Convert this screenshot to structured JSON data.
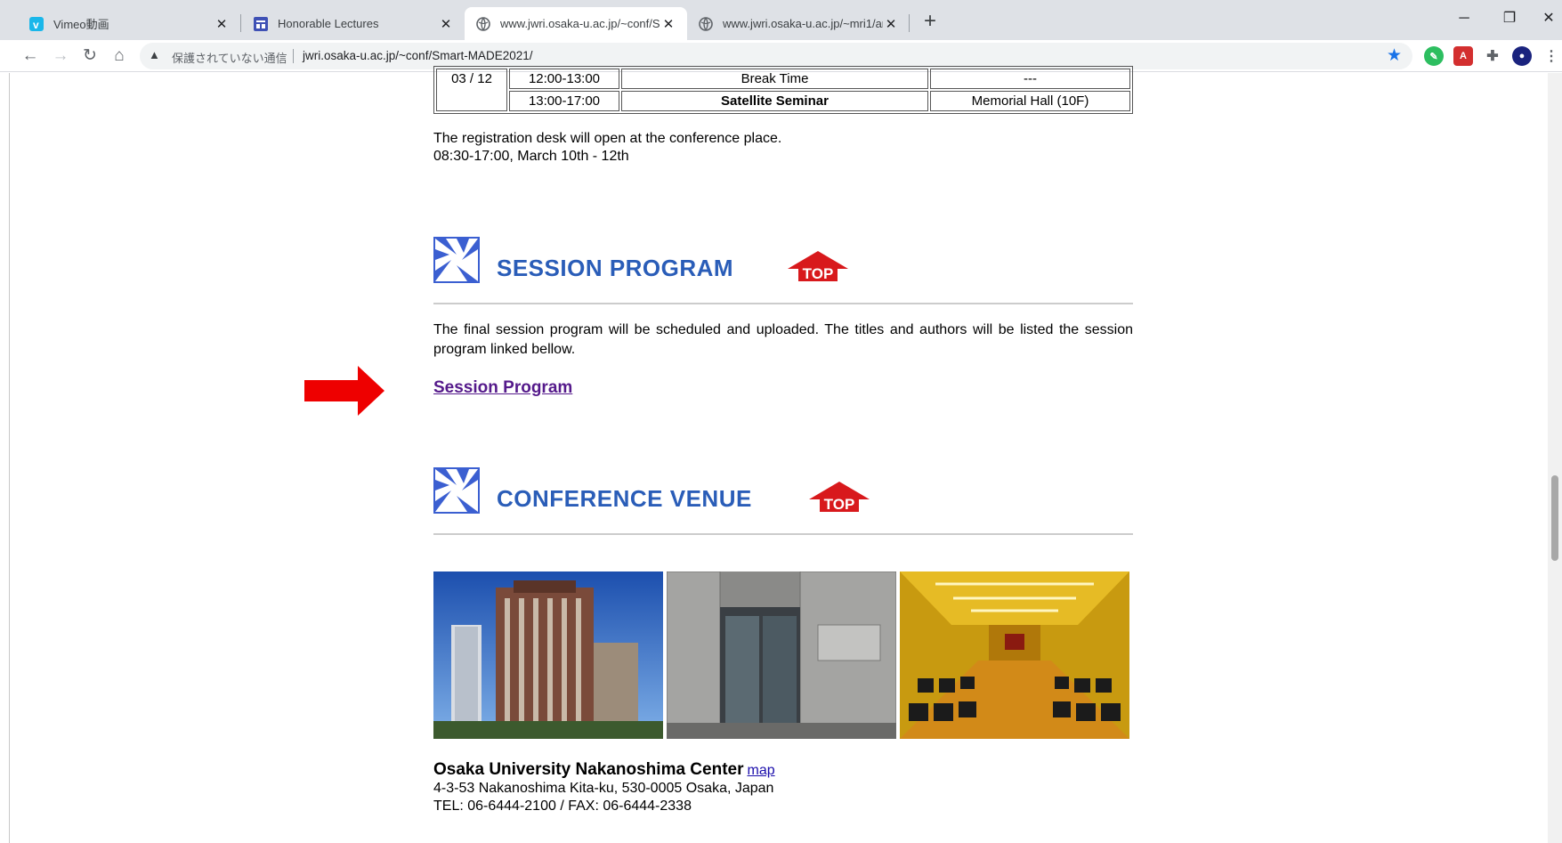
{
  "browser": {
    "tabs": [
      {
        "title": "Vimeo動画",
        "icon": "vimeo-icon"
      },
      {
        "title": "Honorable Lectures",
        "icon": "page-icon"
      },
      {
        "title": "www.jwri.osaka-u.ac.jp/~conf/Sm",
        "icon": "globe-icon",
        "active": true
      },
      {
        "title": "www.jwri.osaka-u.ac.jp/~mri1/an",
        "icon": "globe-icon"
      }
    ],
    "security_label": "保護されていない通信",
    "url": "jwri.osaka-u.ac.jp/~conf/Smart-MADE2021/"
  },
  "schedule": {
    "date": "03 / 12",
    "rows": [
      {
        "time": "12:00-13:00",
        "event": "Break Time",
        "place": "---"
      },
      {
        "time": "13:00-17:00",
        "event": "Satellite Seminar",
        "place": "Memorial Hall (10F)"
      }
    ]
  },
  "registration": {
    "line1": "The registration desk will open at the conference place.",
    "line2": "08:30-17:00, March 10th - 12th"
  },
  "session_program": {
    "heading": "SESSION PROGRAM",
    "top_label": "TOP",
    "text": "The final session program will be scheduled and uploaded. The titles and authors will be listed the session program linked bellow.",
    "link": "Session Program"
  },
  "conference_venue": {
    "heading": "CONFERENCE VENUE",
    "top_label": "TOP",
    "name": "Osaka University Nakanoshima Center",
    "map_link": "map",
    "address": "4-3-53 Nakanoshima Kita-ku, 530-0005 Osaka, Japan",
    "tel": "TEL: 06-6444-2100 / FAX: 06-6444-2338"
  },
  "colors": {
    "heading": "#2a5db8",
    "top_button": "#d8191c",
    "arrow": "#ee0000",
    "link_visited": "#551a8b"
  }
}
